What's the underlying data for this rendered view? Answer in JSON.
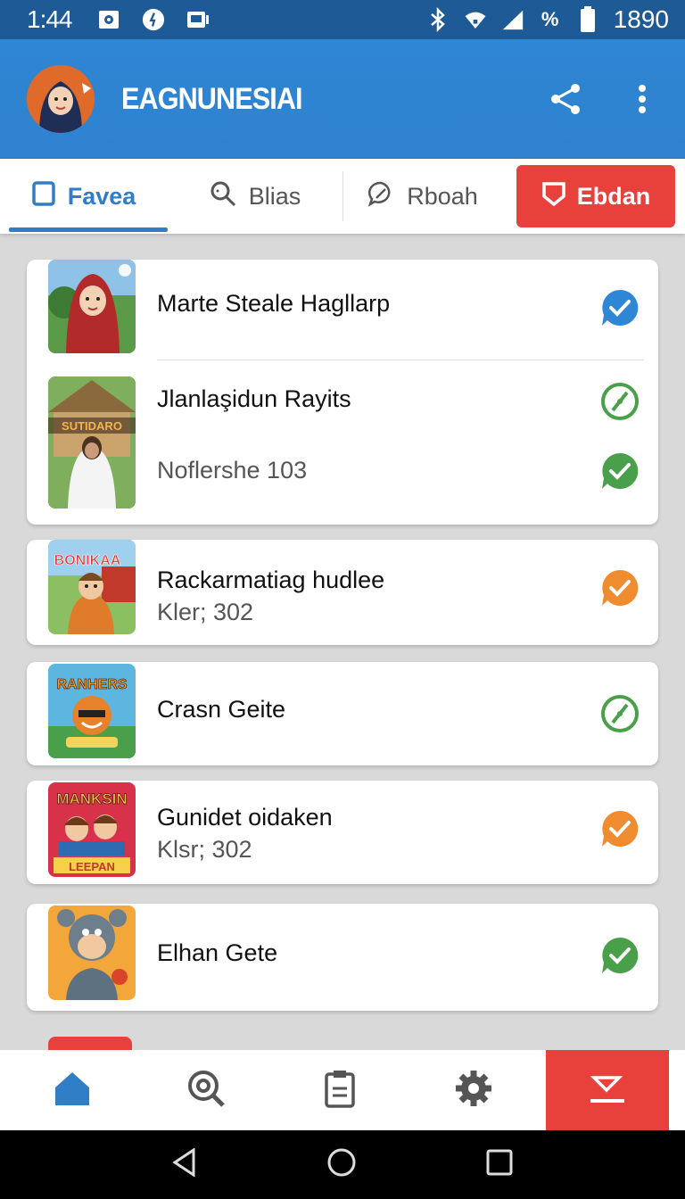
{
  "status_bar": {
    "time": "1:44",
    "battery": "1890",
    "left_icons": [
      "notification-icon",
      "sync-icon",
      "cast-icon"
    ],
    "right_icons": [
      "bluetooth-icon",
      "wifi-icon",
      "signal-icon",
      "percent-icon",
      "battery-icon"
    ]
  },
  "app_bar": {
    "title": "EAGNUNESIAI",
    "actions": [
      "share-icon",
      "more-vert-icon"
    ]
  },
  "tabs": [
    {
      "label": "Favea",
      "icon": "bookmark-icon",
      "active": true
    },
    {
      "label": "Blias",
      "icon": "search-icon",
      "active": false
    },
    {
      "label": "Rboah",
      "icon": "chat-icon",
      "active": false
    }
  ],
  "tab_cta": {
    "label": "Ebdan",
    "icon": "shield-icon"
  },
  "cards": [
    {
      "rows": [
        {
          "title": "Marte Steale Hagllarp",
          "subtitle": "",
          "badge": "check",
          "badge_color": "#2f86d4"
        },
        {
          "title": "Jlanlaşidun Rayits",
          "subtitle": "Noflershe 103",
          "badge": "no-entry",
          "badge_color": "#4aa04a",
          "badge2": "check",
          "badge2_color": "#4aa04a",
          "thumb_text": "SUTIDARO"
        }
      ]
    }
  ],
  "list_items": [
    {
      "title": "Rackarmatiag hudlee",
      "subtitle": "Kler; 302",
      "badge": "check",
      "badge_color": "#ef8c2f",
      "thumb_text": "BONIKAA"
    },
    {
      "title": "Crasn Geite",
      "subtitle": "",
      "badge": "no-entry",
      "badge_color": "#4aa04a",
      "thumb_text": "RANHERS"
    },
    {
      "title": "Gunidet oidaken",
      "subtitle": "Klsr; 302",
      "badge": "check",
      "badge_color": "#ef8c2f",
      "thumb_text": "MANKSIN",
      "thumb_text2": "LEEPAN"
    },
    {
      "title": "Elhan Gete",
      "subtitle": "",
      "badge": "check",
      "badge_color": "#4aa04a"
    }
  ],
  "bottom_nav": [
    {
      "icon": "home-icon",
      "active": true
    },
    {
      "icon": "search-icon",
      "active": false
    },
    {
      "icon": "clipboard-icon",
      "active": false
    },
    {
      "icon": "gear-icon",
      "active": false
    },
    {
      "icon": "send-icon",
      "active": false
    }
  ],
  "colors": {
    "primary": "#2f86d4",
    "accent": "#e8413b",
    "success": "#4aa04a",
    "warning": "#ef8c2f"
  }
}
